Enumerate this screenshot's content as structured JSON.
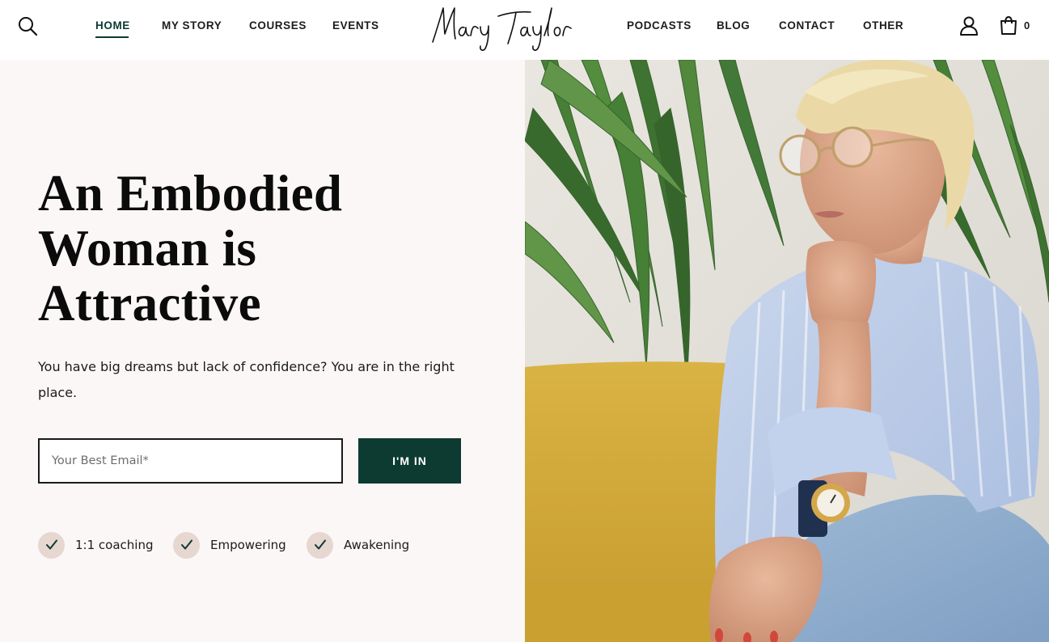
{
  "header": {
    "nav_left": [
      {
        "label": "HOME",
        "active": true
      },
      {
        "label": "MY STORY"
      },
      {
        "label": "COURSES"
      },
      {
        "label": "EVENTS"
      }
    ],
    "logo_text": "Mary Taylor",
    "nav_right": [
      {
        "label": "PODCASTS"
      },
      {
        "label": "BLOG"
      },
      {
        "label": "CONTACT"
      },
      {
        "label": "OTHER"
      }
    ],
    "cart_count": "0"
  },
  "hero": {
    "title_lines": [
      "An Embodied",
      "Woman is",
      "Attractive"
    ],
    "subtitle": "You have big dreams but lack of confidence? You are in the right place.",
    "email_placeholder": "Your Best Email*",
    "cta_label": "I'M IN",
    "features": [
      "1:1 coaching",
      "Empowering",
      "Awakening"
    ]
  },
  "colors": {
    "accent": "#0d3a31",
    "hero_background": "#fbf7f6",
    "check_circle": "#e6d7d0"
  },
  "icons": [
    "search-icon",
    "user-icon",
    "shopping-bag-icon",
    "check-icon"
  ]
}
